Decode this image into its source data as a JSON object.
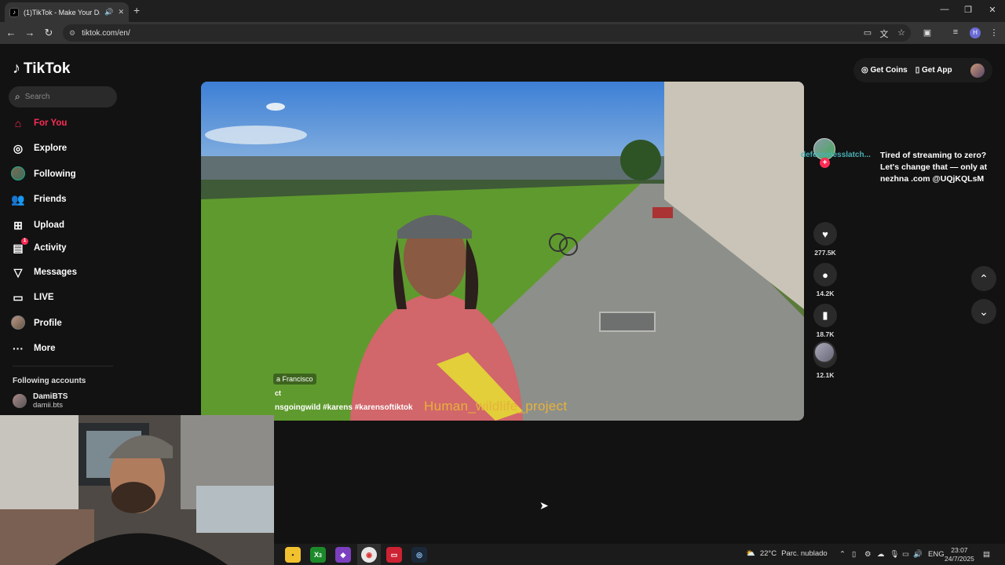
{
  "browser": {
    "tab_title": "(1)TikTok - Make Your Day",
    "url": "tiktok.com/en/"
  },
  "sidebar": {
    "logo": "TikTok",
    "search_placeholder": "Search",
    "items": [
      {
        "label": "For You",
        "icon": "home-icon"
      },
      {
        "label": "Explore",
        "icon": "compass-icon"
      },
      {
        "label": "Following",
        "icon": "following-avatar"
      },
      {
        "label": "Friends",
        "icon": "friends-icon"
      },
      {
        "label": "Upload",
        "icon": "upload-icon"
      },
      {
        "label": "Activity",
        "icon": "activity-icon",
        "badge": "1"
      },
      {
        "label": "Messages",
        "icon": "messages-icon"
      },
      {
        "label": "LIVE",
        "icon": "live-icon"
      },
      {
        "label": "Profile",
        "icon": "profile-avatar"
      },
      {
        "label": "More",
        "icon": "more-icon"
      }
    ],
    "following_title": "Following accounts",
    "account": {
      "name": "DamiBTS",
      "handle": "damii.bts"
    }
  },
  "header": {
    "get_coins": "Get Coins",
    "get_app": "Get App"
  },
  "video": {
    "location": "a Francisco",
    "caption_fragment": "ct",
    "hashtags": "nsgoingwild  #karens  #karensoftiktok",
    "overlay_text": "Human_wildlife_project"
  },
  "actions": {
    "creator": "defenselesslatch...",
    "likes": "277.5K",
    "comments": "14.2K",
    "saves": "18.7K",
    "shares": "12.1K"
  },
  "ad_text": "Tired of streaming to zero? Let's change that — only at nezhna .com @UQjKQLsM",
  "taskbar": {
    "weather_temp": "22°C",
    "weather_desc": "Parc. nublado",
    "lang": "ENG",
    "time": "23:07",
    "date": "24/7/2025",
    "xbox_badge": "3"
  }
}
